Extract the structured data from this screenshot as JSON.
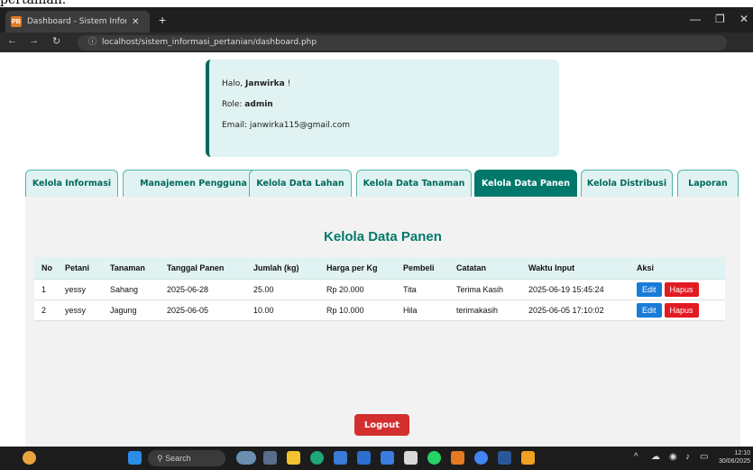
{
  "top_fragment": "pertanian.",
  "browser": {
    "tab_title": "Dashboard - Sistem Informasi P",
    "tab_favicon": "PB",
    "url": "localhost/sistem_informasi_pertanian/dashboard.php"
  },
  "profile": {
    "greeting_prefix": "Halo, ",
    "name": "Janwirka",
    "greeting_suffix": " !",
    "role_label": "Role: ",
    "role": "admin",
    "email": "Email: janwirka115@gmail.com"
  },
  "nav_tabs": [
    {
      "label": "Kelola Informasi"
    },
    {
      "label": "Manajemen Pengguna"
    },
    {
      "label": "Kelola Data Lahan"
    },
    {
      "label": "Kelola Data Tanaman"
    },
    {
      "label": "Kelola Data Panen"
    },
    {
      "label": "Kelola Distribusi"
    },
    {
      "label": "Laporan"
    }
  ],
  "main": {
    "title": "Kelola Data Panen",
    "columns": [
      "No",
      "Petani",
      "Tanaman",
      "Tanggal Panen",
      "Jumlah (kg)",
      "Harga per Kg",
      "Pembeli",
      "Catatan",
      "Waktu Input",
      "Aksi"
    ],
    "rows": [
      {
        "no": "1",
        "petani": "yessy",
        "tanaman": "Sahang",
        "tanggal": "2025-06-28",
        "jumlah": "25.00",
        "harga": "Rp 20.000",
        "pembeli": "Tita",
        "catatan": "Terima Kasih",
        "waktu": "2025-06-19 15:45:24"
      },
      {
        "no": "2",
        "petani": "yessy",
        "tanaman": "Jagung",
        "tanggal": "2025-06-05",
        "jumlah": "10.00",
        "harga": "Rp 10.000",
        "pembeli": "Hila",
        "catatan": "terimakasih",
        "waktu": "2025-06-05 17:10:02"
      }
    ],
    "edit_label": "Edit",
    "delete_label": "Hapus",
    "logout_label": "Logout"
  },
  "taskbar": {
    "search_placeholder": "Search",
    "time": "12:10",
    "date": "30/06/2025"
  },
  "colors": {
    "accent": "#00796b",
    "danger": "#d32f2f",
    "edit": "#1a7bd8"
  }
}
